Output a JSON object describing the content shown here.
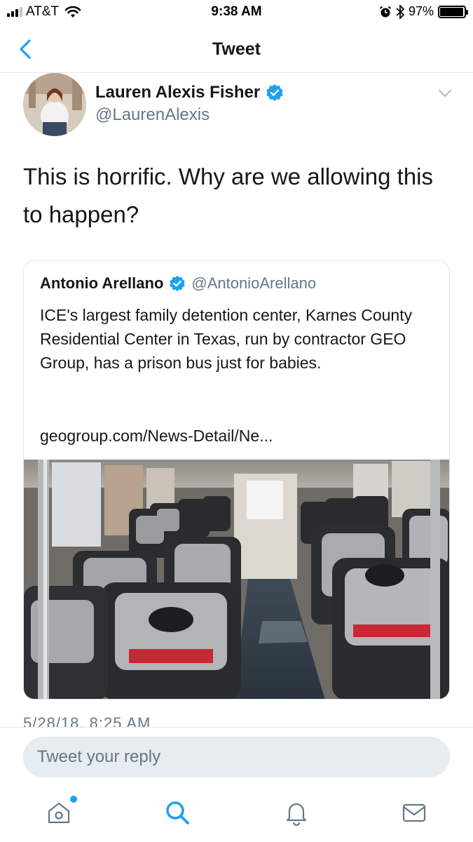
{
  "status_bar": {
    "carrier": "AT&T",
    "time": "9:38 AM",
    "battery": "97%",
    "battery_level": 0.97
  },
  "nav": {
    "title": "Tweet"
  },
  "tweet": {
    "author_name": "Lauren Alexis Fisher",
    "author_handle": "@LaurenAlexis",
    "text": "This is horrific. Why are we allowing this to happen?",
    "timestamp": "5/28/18, 8:25 AM",
    "quoted": {
      "author_name": "Antonio Arellano",
      "author_handle": "@AntonioArellano",
      "text": "ICE's largest family detention center, Karnes County Residential Center in Texas, run by contractor GEO Group, has a prison bus just for babies.",
      "link": "geogroup.com/News-Detail/Ne..."
    }
  },
  "reply": {
    "placeholder": "Tweet your reply"
  },
  "colors": {
    "accent": "#1da1f2",
    "text": "#14171a",
    "secondary": "#657786"
  },
  "tabs": [
    {
      "icon": "home-icon"
    },
    {
      "icon": "search-icon"
    },
    {
      "icon": "bell-icon"
    },
    {
      "icon": "mail-icon"
    }
  ]
}
